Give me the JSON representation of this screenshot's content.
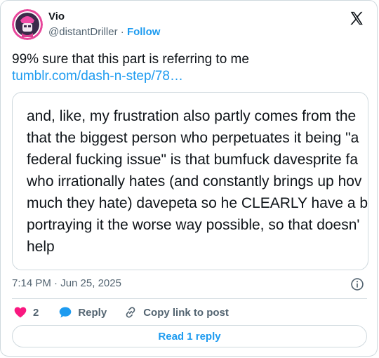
{
  "author": {
    "name": "Vio",
    "handle": "@distantDriller",
    "separator": " · ",
    "follow_label": "Follow"
  },
  "tweet": {
    "text": "99% sure that this part is referring to me",
    "link": "tumblr.com/dash-n-step/78…"
  },
  "quote": {
    "text": "and, like, my frustration also partly comes from the\nthat the biggest person who perpetuates it being \"a\nfederal fucking issue\" is that bumfuck davesprite fa\nwho irrationally hates (and constantly brings up hov\nmuch they hate) davepeta so he CLEARLY have a b\nportraying it the worse way possible, so that doesn'\nhelp"
  },
  "meta": {
    "timestamp": "7:14 PM · Jun 25, 2025"
  },
  "actions": {
    "like_count": "2",
    "reply_label": "Reply",
    "copy_link_label": "Copy link to post",
    "read_reply_label": "Read 1 reply"
  },
  "colors": {
    "accent": "#1d9bf0",
    "like": "#f91880",
    "muted": "#536471",
    "border": "#cfd9de"
  },
  "icons": [
    "x-logo-icon",
    "info-icon",
    "heart-icon",
    "reply-bubble-icon",
    "link-icon"
  ]
}
